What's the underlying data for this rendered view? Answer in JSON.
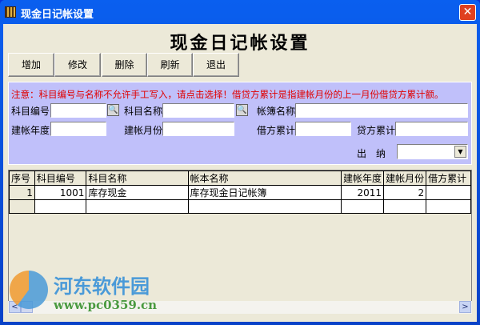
{
  "window": {
    "title": "现金日记帐设置",
    "close": "✕"
  },
  "page_title": "现金日记帐设置",
  "toolbar": {
    "add": "增加",
    "edit": "修改",
    "delete": "删除",
    "refresh": "刷新",
    "exit": "退出"
  },
  "form": {
    "notice": "注意：科目编号与名称不允许手工写入，请点击选择！借贷方累计是指建帐月份的上一月份借贷方累计额。",
    "account_code_label": "科目编号",
    "account_code_value": "",
    "account_name_label": "科目名称",
    "account_name_value": "",
    "ledger_name_label": "帐簿名称",
    "ledger_name_value": "",
    "year_label": "建帐年度",
    "year_value": "",
    "month_label": "建帐月份",
    "month_value": "",
    "debit_label": "借方累计",
    "debit_value": "",
    "credit_label": "贷方累计",
    "credit_value": "",
    "cashier_label": "出　纳",
    "cashier_value": ""
  },
  "grid": {
    "columns": [
      "序号",
      "科目编号",
      "科目名称",
      "帐本名称",
      "建帐年度",
      "建帐月份",
      "借方累计"
    ],
    "rows": [
      {
        "no": "1",
        "code": "1001",
        "name": "库存现金",
        "ledger": "库存现金日记帐簿",
        "year": "2011",
        "month": "2",
        "debit": ""
      }
    ]
  },
  "watermark": {
    "name": "河东软件园",
    "url": "www.pc0359.cn"
  }
}
